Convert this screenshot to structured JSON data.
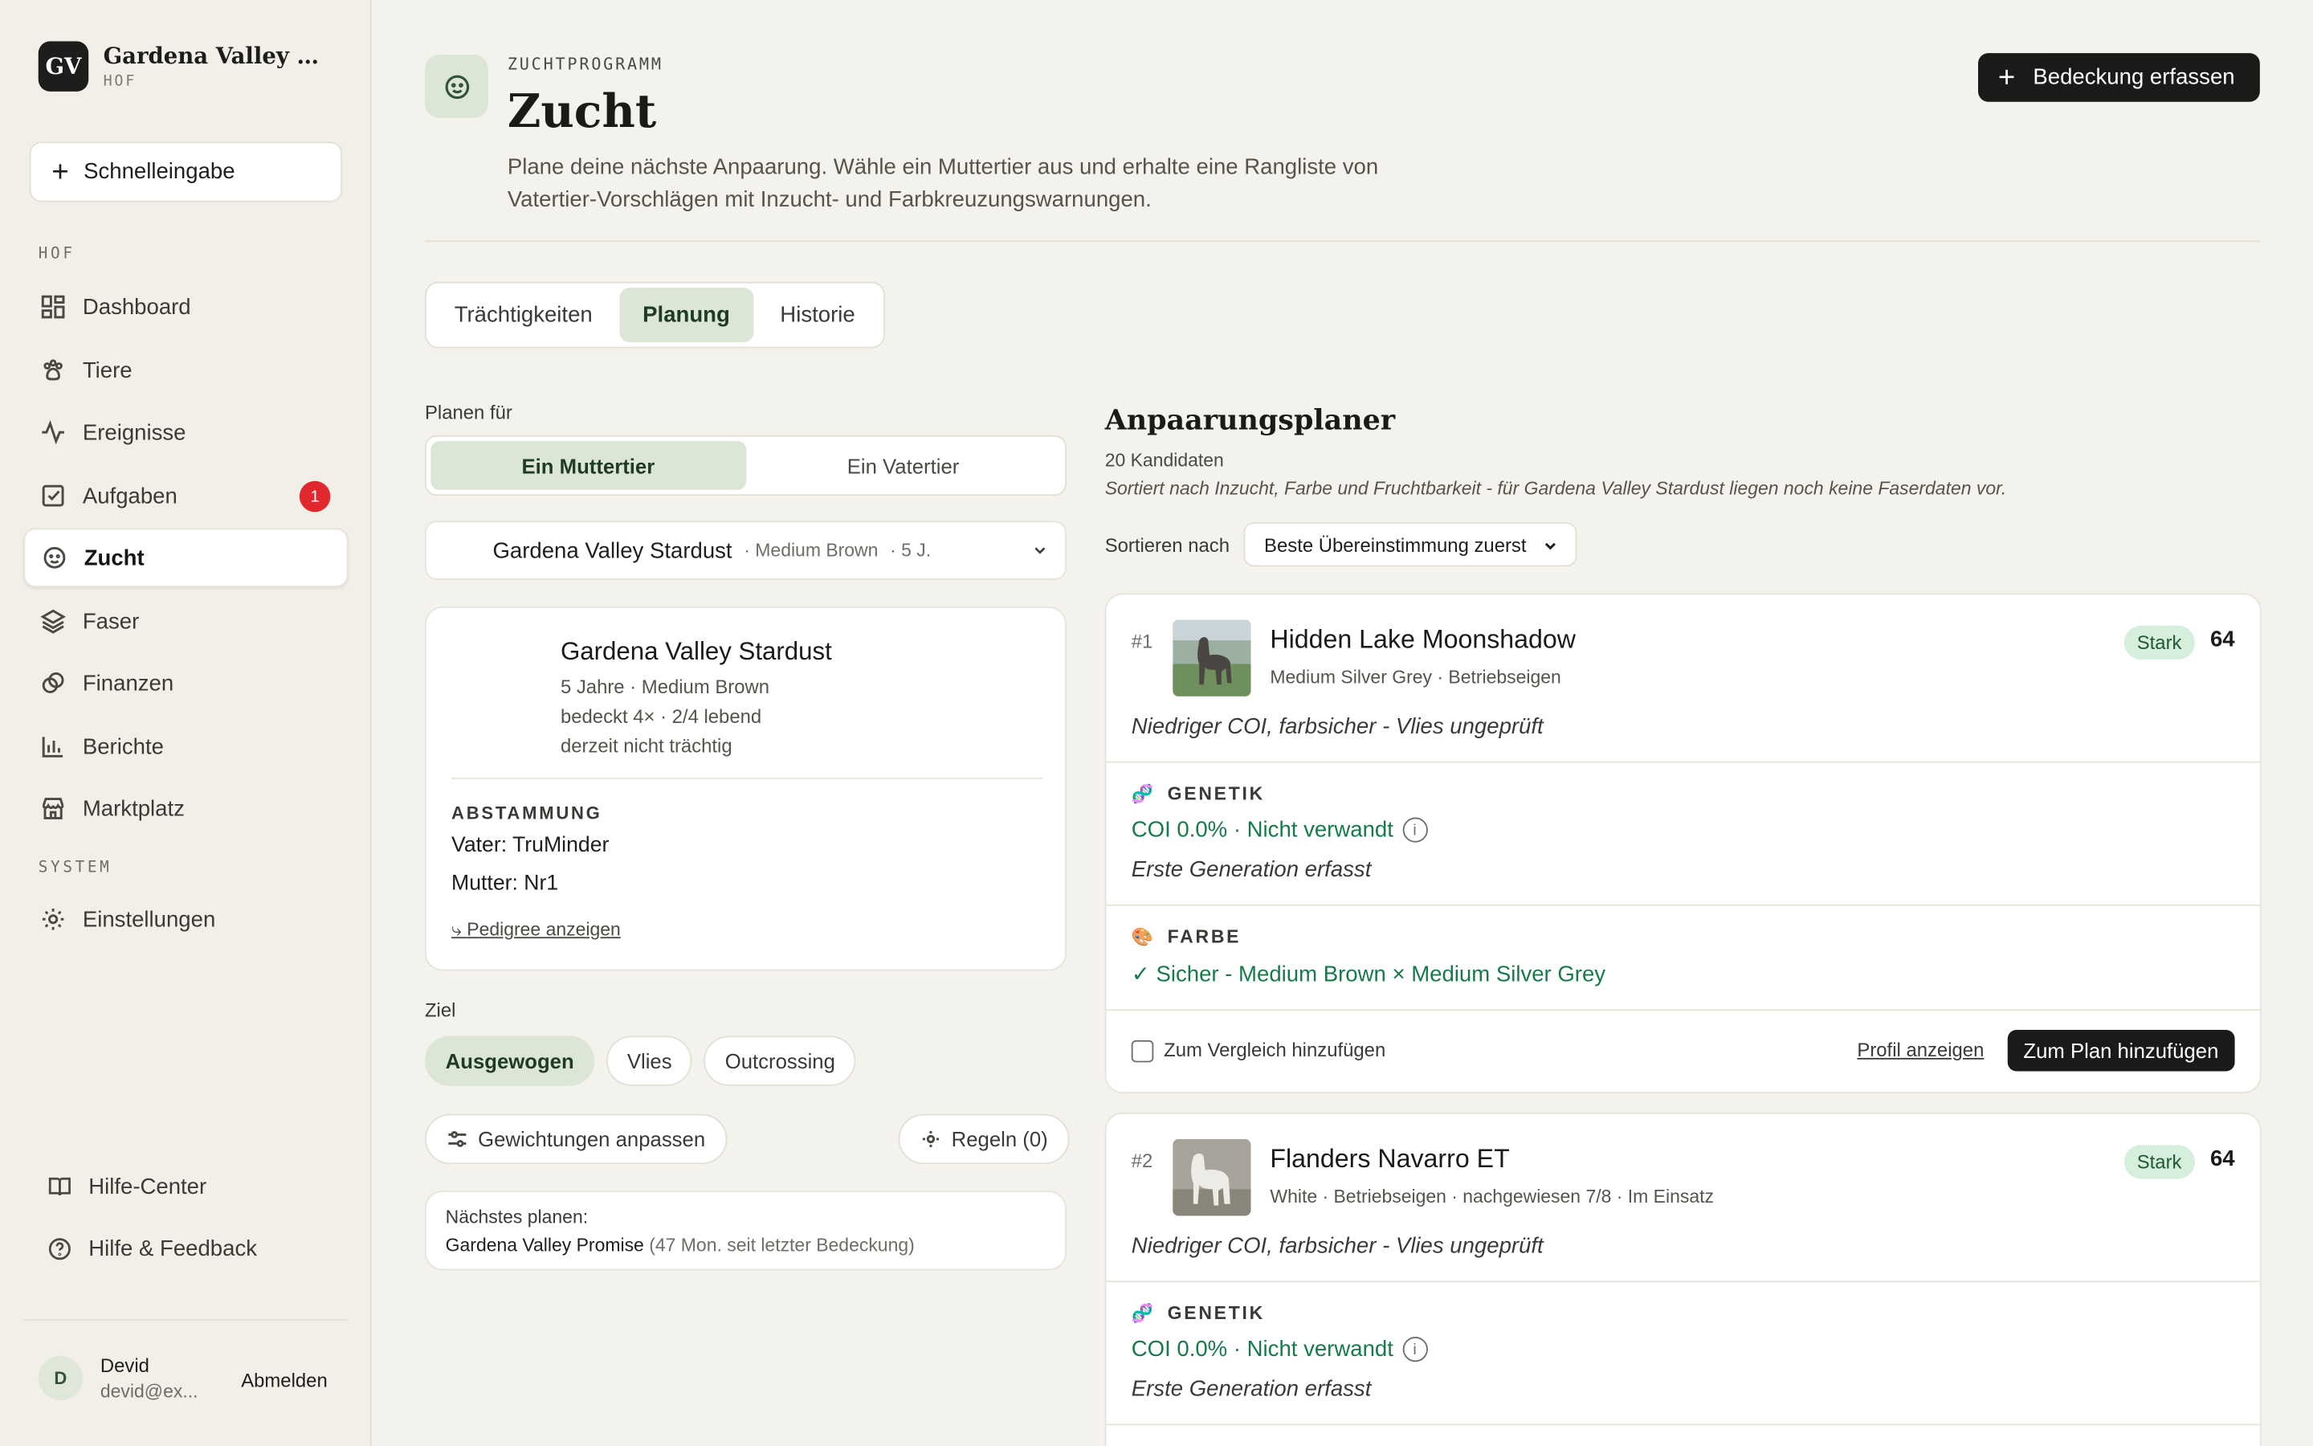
{
  "brand": {
    "logo": "GV",
    "name": "Gardena Valley Alp...",
    "sub": "HOF"
  },
  "sidebar": {
    "quick_add": "Schnelleingabe",
    "section_farm": "HOF",
    "section_system": "SYSTEM",
    "items": [
      {
        "label": "Dashboard",
        "icon": "dashboard-icon"
      },
      {
        "label": "Tiere",
        "icon": "paw-icon"
      },
      {
        "label": "Ereignisse",
        "icon": "activity-icon"
      },
      {
        "label": "Aufgaben",
        "icon": "checkbox-icon",
        "badge": "1"
      },
      {
        "label": "Zucht",
        "icon": "breeding-icon",
        "active": true
      },
      {
        "label": "Faser",
        "icon": "layers-icon"
      },
      {
        "label": "Finanzen",
        "icon": "coins-icon"
      },
      {
        "label": "Berichte",
        "icon": "chart-icon"
      },
      {
        "label": "Marktplatz",
        "icon": "store-icon"
      }
    ],
    "settings": "Einstellungen",
    "help_center": "Hilfe-Center",
    "help_feedback": "Hilfe & Feedback",
    "user": {
      "initial": "D",
      "name": "Devid",
      "email": "devid@ex...",
      "logout": "Abmelden"
    }
  },
  "header": {
    "kicker": "ZUCHTPROGRAMM",
    "title": "Zucht",
    "description": "Plane deine nächste Anpaarung. Wähle ein Muttertier aus und erhalte eine Rangliste von Vatertier-Vorschlägen mit Inzucht- und Farbkreuzungswarnungen.",
    "primary_button": "Bedeckung erfassen"
  },
  "tabs": [
    "Trächtigkeiten",
    "Planung",
    "Historie"
  ],
  "planner_left": {
    "plan_for_label": "Planen für",
    "segments": [
      "Ein Muttertier",
      "Ein Vatertier"
    ],
    "selected_dam": {
      "name": "Gardena Valley Stardust",
      "meta1": "· Medium Brown",
      "meta2": "· 5 J."
    },
    "dam_card": {
      "name": "Gardena Valley Stardust",
      "line1": "5 Jahre · Medium Brown",
      "line2": "bedeckt 4× · 2/4 lebend",
      "line3": "derzeit nicht trächtig",
      "lineage_label": "ABSTAMMUNG",
      "sire": "Vater: TruMinder",
      "dam": "Mutter: Nr1",
      "pedigree_link": "Pedigree anzeigen"
    },
    "goal_label": "Ziel",
    "goals": [
      "Ausgewogen",
      "Vlies",
      "Outcrossing"
    ],
    "weights_button": "Gewichtungen anpassen",
    "rules_button": "Regeln (0)",
    "next": {
      "label": "Nächstes planen:",
      "name": "Gardena Valley Promise",
      "detail": "(47 Mon. seit letzter Bedeckung)"
    }
  },
  "planner_right": {
    "title": "Anpaarungsplaner",
    "count": "20 Kandidaten",
    "note": "Sortiert nach Inzucht, Farbe und Fruchtbarkeit - für Gardena Valley Stardust liegen noch keine Faserdaten vor.",
    "sort_label": "Sortieren nach",
    "sort_value": "Beste Übereinstimmung zuerst",
    "candidates": [
      {
        "rank": "#1",
        "name": "Hidden Lake Moonshadow",
        "meta": "Medium Silver Grey · Betriebseigen",
        "strength": "Stark",
        "score": "64",
        "summary": "Niedriger COI, farbsicher - Vlies ungeprüft",
        "genetics_label": "GENETIK",
        "genetics_value": "COI 0.0% · Nicht verwandt",
        "genetics_note": "Erste Generation erfasst",
        "color_label": "FARBE",
        "color_value": "✓ Sicher - Medium Brown × Medium Silver Grey",
        "compare": "Zum Vergleich hinzufügen",
        "profile": "Profil anzeigen",
        "add": "Zum Plan hinzufügen"
      },
      {
        "rank": "#2",
        "name": "Flanders Navarro ET",
        "meta": "White · Betriebseigen · nachgewiesen 7/8 · Im Einsatz",
        "strength": "Stark",
        "score": "64",
        "summary": "Niedriger COI, farbsicher - Vlies ungeprüft",
        "genetics_label": "GENETIK",
        "genetics_value": "COI 0.0% · Nicht verwandt",
        "genetics_note": "Erste Generation erfasst"
      }
    ]
  }
}
